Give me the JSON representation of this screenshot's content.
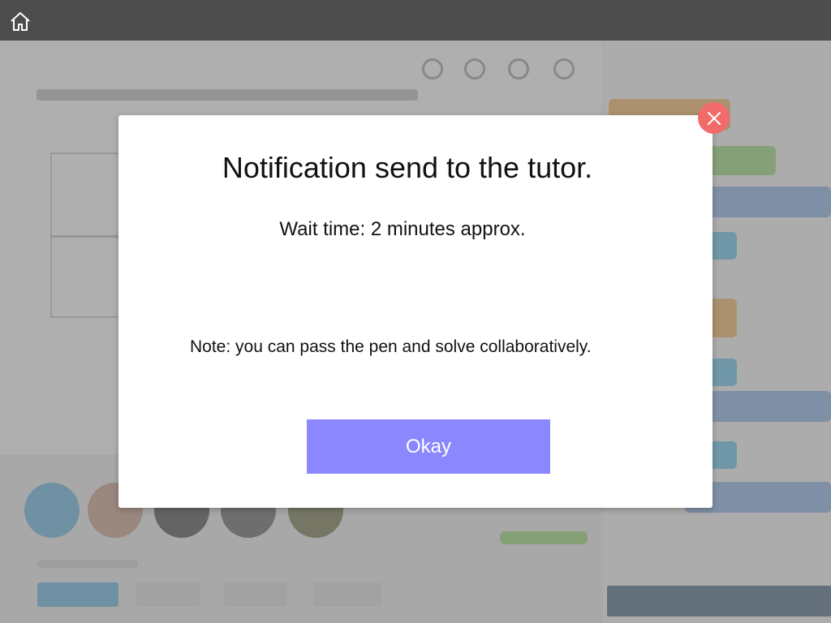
{
  "topbar": {
    "home_icon": "home-icon"
  },
  "dialog": {
    "title": "Notification send to the tutor.",
    "wait_text": "Wait time: 2 minutes approx.",
    "note_text": "Note: you can pass the pen and solve collaboratively.",
    "okay_label": "Okay",
    "close_icon": "close-icon"
  },
  "colors": {
    "topbar": "#4d4d4d",
    "okay_button": "#8a87ff",
    "close_button": "#f16b6b"
  }
}
